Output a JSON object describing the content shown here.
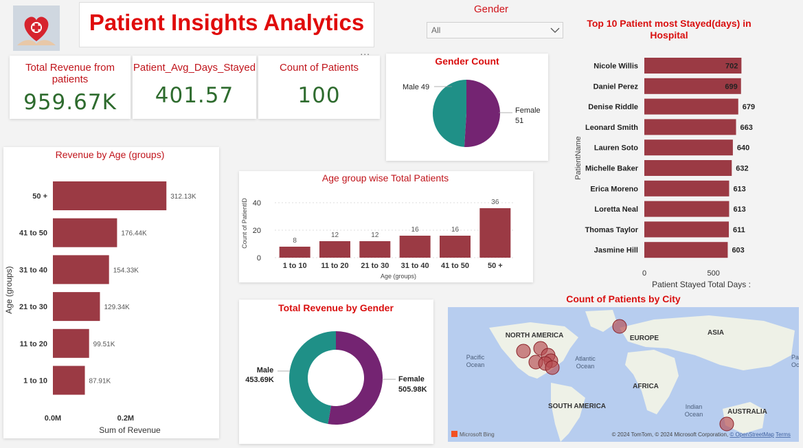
{
  "header": {
    "title": "Patient Insights Analytics",
    "logo_icon": "heart-care-logo-icon"
  },
  "filter": {
    "label": "Gender",
    "selected": "All"
  },
  "kpis": [
    {
      "label": "Total Revenue from patients",
      "value": "959.67K"
    },
    {
      "label": "Patient_Avg_Days_Stayed",
      "value": "401.57"
    },
    {
      "label": "Count of Patients",
      "value": "100"
    }
  ],
  "more_options": "...",
  "colors": {
    "bar": "#9b3a44",
    "male": "#1f9087",
    "female": "#742472",
    "title": "#d90f0f",
    "kpi_value": "#2e6b2e",
    "map_water": "#b7cdef",
    "map_land": "#eef1e7"
  },
  "chart_data": [
    {
      "id": "revenue_by_age",
      "type": "bar",
      "orientation": "horizontal",
      "title": "Revenue by Age (groups)",
      "xlabel": "Sum of Revenue",
      "ylabel": "Age (groups)",
      "categories": [
        "50 +",
        "41 to 50",
        "31 to 40",
        "21 to 30",
        "11 to 20",
        "1 to 10"
      ],
      "values": [
        312130,
        176440,
        154330,
        129340,
        99510,
        87910
      ],
      "data_labels": [
        "312.13K",
        "176.44K",
        "154.33K",
        "129.34K",
        "99.51K",
        "87.91K"
      ],
      "xticks": [
        "0.0M",
        "0.2M"
      ],
      "xlim": [
        0,
        340000
      ]
    },
    {
      "id": "age_group_patients",
      "type": "bar",
      "title": "Age group wise Total Patients",
      "xlabel": "Age (groups)",
      "ylabel": "Count of PatientID",
      "categories": [
        "1 to 10",
        "11 to 20",
        "21 to 30",
        "31 to 40",
        "41 to 50",
        "50 +"
      ],
      "values": [
        8,
        12,
        12,
        16,
        16,
        36
      ],
      "yticks": [
        0,
        20,
        40
      ],
      "ylim": [
        0,
        44
      ],
      "grid": true
    },
    {
      "id": "gender_count",
      "type": "pie",
      "title": "Gender Count",
      "categories": [
        "Male",
        "Female"
      ],
      "values": [
        49,
        51
      ]
    },
    {
      "id": "revenue_by_gender",
      "type": "pie",
      "variant": "donut",
      "title": "Total Revenue by Gender",
      "categories": [
        "Male",
        "Female"
      ],
      "values": [
        453.69,
        505.98
      ],
      "data_labels": [
        "453.69K",
        "505.98K"
      ]
    },
    {
      "id": "top10_stayed",
      "type": "bar",
      "orientation": "horizontal",
      "title": "Top 10 Patient most Stayed(days) in Hospital",
      "xlabel": "Patient Stayed Total Days :",
      "ylabel": "PatientName",
      "categories": [
        "Nicole Willis",
        "Daniel Perez",
        "Denise Riddle",
        "Leonard Smith",
        "Lauren Soto",
        "Michelle Baker",
        "Erica Moreno",
        "Loretta Neal",
        "Thomas Taylor",
        "Jasmine Hill"
      ],
      "values": [
        702,
        699,
        679,
        663,
        640,
        632,
        613,
        613,
        611,
        603
      ],
      "xticks": [
        0,
        500
      ],
      "xlim": [
        0,
        720
      ]
    }
  ],
  "map": {
    "title": "Count of Patients by City",
    "labels": {
      "north_america": "NORTH AMERICA",
      "europe": "EUROPE",
      "asia": "ASIA",
      "africa": "AFRICA",
      "south_america": "SOUTH AMERICA",
      "australia": "AUSTRALIA",
      "pacific": "Pacific Ocean",
      "atlantic": "Atlantic Ocean",
      "indian": "Indian Ocean",
      "pacific_right": "Paci Oce"
    },
    "brand": "Microsoft Bing",
    "attribution": "© 2024 TomTom, © 2024 Microsoft Corporation,",
    "osm": "© OpenStreetMap",
    "terms": "Terms"
  }
}
